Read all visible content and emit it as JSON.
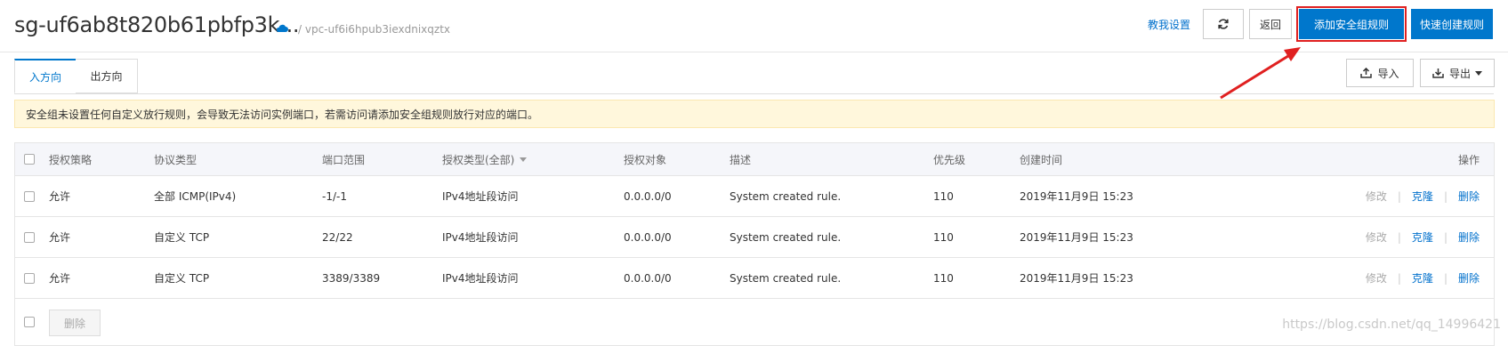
{
  "header": {
    "title": "sg-uf6ab8t820b61pbfp3k...",
    "cloud_icon": "cloud-icon",
    "vpc": "/ vpc-uf6i6hpub3iexdnixqztx",
    "help_link": "教我设置",
    "refresh_icon": "refresh-icon",
    "back_label": "返回",
    "add_rule_label": "添加安全组规则",
    "quick_create_label": "快速创建规则"
  },
  "tabs": [
    {
      "label": "入方向",
      "active": true
    },
    {
      "label": "出方向",
      "active": false
    }
  ],
  "toolbar": {
    "import_label": "导入",
    "export_label": "导出"
  },
  "notice": "安全组未设置任何自定义放行规则，会导致无法访问实例端口，若需访问请添加安全组规则放行对应的端口。",
  "table": {
    "columns": [
      "授权策略",
      "协议类型",
      "端口范围",
      "授权类型(全部)",
      "授权对象",
      "描述",
      "优先级",
      "创建时间",
      "操作"
    ],
    "rows": [
      {
        "policy": "允许",
        "protocol": "全部 ICMP(IPv4)",
        "port": "-1/-1",
        "auth_type": "IPv4地址段访问",
        "object": "0.0.0.0/0",
        "desc": "System created rule.",
        "priority": "110",
        "created": "2019年11月9日 15:23"
      },
      {
        "policy": "允许",
        "protocol": "自定义 TCP",
        "port": "22/22",
        "auth_type": "IPv4地址段访问",
        "object": "0.0.0.0/0",
        "desc": "System created rule.",
        "priority": "110",
        "created": "2019年11月9日 15:23"
      },
      {
        "policy": "允许",
        "protocol": "自定义 TCP",
        "port": "3389/3389",
        "auth_type": "IPv4地址段访问",
        "object": "0.0.0.0/0",
        "desc": "System created rule.",
        "priority": "110",
        "created": "2019年11月9日 15:23"
      }
    ],
    "actions": {
      "edit": "修改",
      "clone": "克隆",
      "delete": "删除"
    },
    "footer_delete": "删除"
  },
  "watermark": "https://blog.csdn.net/qq_14996421",
  "colors": {
    "accent": "#0077cc",
    "annotation": "#e02020",
    "notice_bg": "#fff7dc"
  }
}
